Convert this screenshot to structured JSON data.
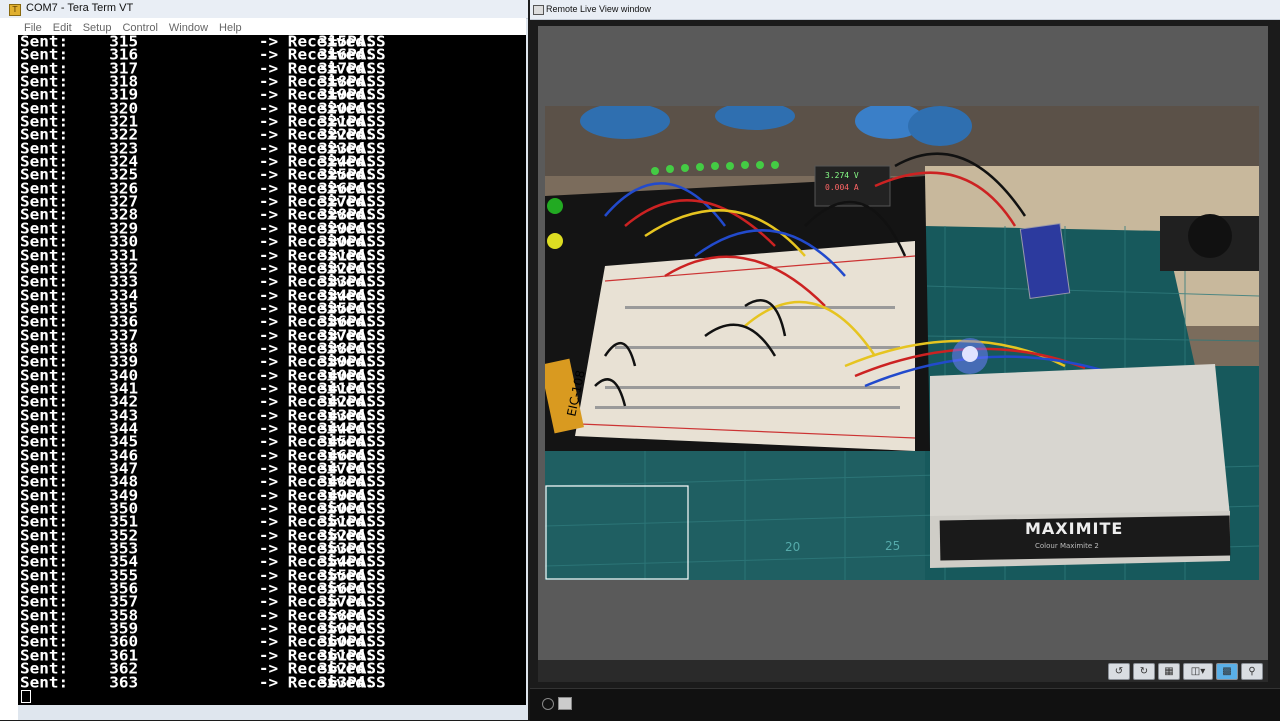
{
  "terminal_window": {
    "title": "COM7 - Tera Term VT",
    "menu": [
      "File",
      "Edit",
      "Setup",
      "Control",
      "Window",
      "Help"
    ],
    "lines": [
      [
        "Sent:",
        "315",
        "-> Received:",
        "315",
        "= PASS"
      ],
      [
        "Sent:",
        "316",
        "-> Received:",
        "316",
        "= PASS"
      ],
      [
        "Sent:",
        "317",
        "-> Received:",
        "317",
        "= PASS"
      ],
      [
        "Sent:",
        "318",
        "-> Received:",
        "318",
        "= PASS"
      ],
      [
        "Sent:",
        "319",
        "-> Received:",
        "319",
        "= PASS"
      ],
      [
        "Sent:",
        "320",
        "-> Received:",
        "320",
        "= PASS"
      ],
      [
        "Sent:",
        "321",
        "-> Received:",
        "321",
        "= PASS"
      ],
      [
        "Sent:",
        "322",
        "-> Received:",
        "322",
        "= PASS"
      ],
      [
        "Sent:",
        "323",
        "-> Received:",
        "323",
        "= PASS"
      ],
      [
        "Sent:",
        "324",
        "-> Received:",
        "324",
        "= PASS"
      ],
      [
        "Sent:",
        "325",
        "-> Received:",
        "325",
        "= PASS"
      ],
      [
        "Sent:",
        "326",
        "-> Received:",
        "326",
        "= PASS"
      ],
      [
        "Sent:",
        "327",
        "-> Received:",
        "327",
        "= PASS"
      ],
      [
        "Sent:",
        "328",
        "-> Received:",
        "328",
        "= PASS"
      ],
      [
        "Sent:",
        "329",
        "-> Received:",
        "329",
        "= PASS"
      ],
      [
        "Sent:",
        "330",
        "-> Received:",
        "330",
        "= PASS"
      ],
      [
        "Sent:",
        "331",
        "-> Received:",
        "331",
        "= PASS"
      ],
      [
        "Sent:",
        "332",
        "-> Received:",
        "332",
        "= PASS"
      ],
      [
        "Sent:",
        "333",
        "-> Received:",
        "333",
        "= PASS"
      ],
      [
        "Sent:",
        "334",
        "-> Received:",
        "334",
        "= PASS"
      ],
      [
        "Sent:",
        "335",
        "-> Received:",
        "335",
        "= PASS"
      ],
      [
        "Sent:",
        "336",
        "-> Received:",
        "336",
        "= PASS"
      ],
      [
        "Sent:",
        "337",
        "-> Received:",
        "337",
        "= PASS"
      ],
      [
        "Sent:",
        "338",
        "-> Received:",
        "338",
        "= PASS"
      ],
      [
        "Sent:",
        "339",
        "-> Received:",
        "339",
        "= PASS"
      ],
      [
        "Sent:",
        "340",
        "-> Received:",
        "340",
        "= PASS"
      ],
      [
        "Sent:",
        "341",
        "-> Received:",
        "341",
        "= PASS"
      ],
      [
        "Sent:",
        "342",
        "-> Received:",
        "342",
        "= PASS"
      ],
      [
        "Sent:",
        "343",
        "-> Received:",
        "343",
        "= PASS"
      ],
      [
        "Sent:",
        "344",
        "-> Received:",
        "344",
        "= PASS"
      ],
      [
        "Sent:",
        "345",
        "-> Received:",
        "345",
        "= PASS"
      ],
      [
        "Sent:",
        "346",
        "-> Received:",
        "346",
        "= PASS"
      ],
      [
        "Sent:",
        "347",
        "-> Received:",
        "347",
        "= PASS"
      ],
      [
        "Sent:",
        "348",
        "-> Received:",
        "348",
        "= PASS"
      ],
      [
        "Sent:",
        "349",
        "-> Received:",
        "349",
        "= PASS"
      ],
      [
        "Sent:",
        "350",
        "-> Received:",
        "350",
        "= PASS"
      ],
      [
        "Sent:",
        "351",
        "-> Received:",
        "351",
        "= PASS"
      ],
      [
        "Sent:",
        "352",
        "-> Received:",
        "352",
        "= PASS"
      ],
      [
        "Sent:",
        "353",
        "-> Received:",
        "353",
        "= PASS"
      ],
      [
        "Sent:",
        "354",
        "-> Received:",
        "354",
        "= PASS"
      ],
      [
        "Sent:",
        "355",
        "-> Received:",
        "355",
        "= PASS"
      ],
      [
        "Sent:",
        "356",
        "-> Received:",
        "356",
        "= PASS"
      ],
      [
        "Sent:",
        "357",
        "-> Received:",
        "357",
        "= PASS"
      ],
      [
        "Sent:",
        "358",
        "-> Received:",
        "358",
        "= PASS"
      ],
      [
        "Sent:",
        "359",
        "-> Received:",
        "359",
        "= PASS"
      ],
      [
        "Sent:",
        "360",
        "-> Received:",
        "360",
        "= PASS"
      ],
      [
        "Sent:",
        "361",
        "-> Received:",
        "361",
        "= PASS"
      ],
      [
        "Sent:",
        "362",
        "-> Received:",
        "362",
        "= PASS"
      ],
      [
        "Sent:",
        "363",
        "-> Received:",
        "363",
        "= PASS"
      ]
    ]
  },
  "live_view_window": {
    "title": "Remote Live View window",
    "photo_text": {
      "case_brand": "MAXIMITE",
      "case_subtitle": "Colour Maximite 2",
      "breadboard_label": "EIC-108",
      "voltmeter_v": "3.274 V",
      "voltmeter_a": "0.004 A",
      "mat_number_left": "20",
      "mat_number_right": "25"
    },
    "controls": [
      "rotate-left-icon",
      "rotate-right-icon",
      "grid-icon",
      "layout-icon",
      "view-icon",
      "zoom-icon"
    ]
  },
  "colors": {
    "terminal_bg": "#000000",
    "terminal_fg": "#ffffff",
    "titlebar": "#e9eef5",
    "viewer_bg": "#5a5a5a"
  }
}
